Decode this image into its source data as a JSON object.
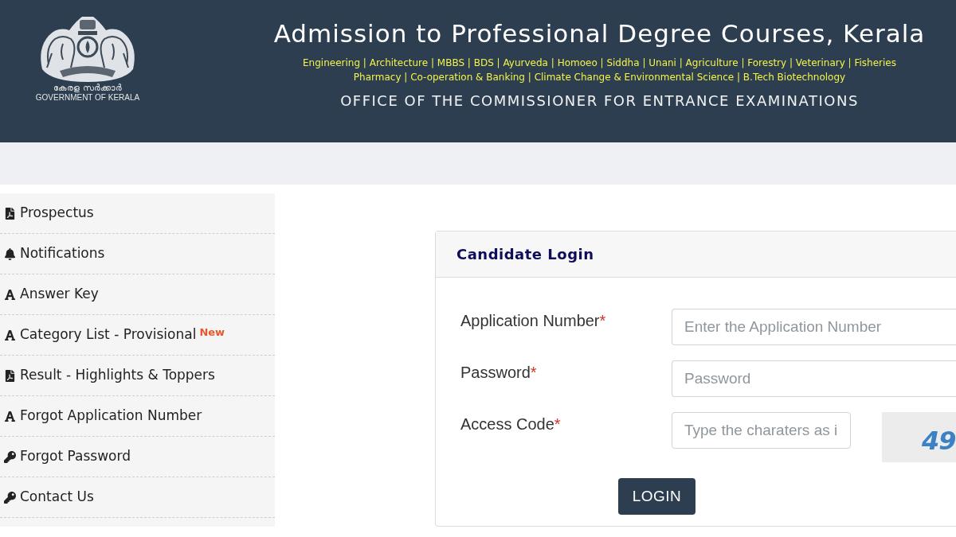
{
  "header": {
    "emblem_caption_native": "കേരള സർക്കാർ",
    "emblem_caption": "GOVERNMENT OF KERALA",
    "title": "Admission to Professional Degree Courses, Kerala",
    "course_lines": [
      "Engineering | Architecture | MBBS | BDS | Ayurveda | Homoeo | Siddha | Unani | Agriculture | Forestry | Veterinary | Fisheries",
      "Pharmacy | Co-operation & Banking | Climate Change & Environmental Science | B.Tech Biotechnology"
    ],
    "office": "OFFICE OF THE COMMISSIONER FOR ENTRANCE EXAMINATIONS"
  },
  "sidebar": {
    "items": [
      {
        "label": "Prospectus"
      },
      {
        "label": "Notifications"
      },
      {
        "label": "Answer Key"
      },
      {
        "label": "Category List - Provisional",
        "badge": "New"
      },
      {
        "label": "Result - Highlights & Toppers"
      },
      {
        "label": "Forgot Application Number"
      },
      {
        "label": "Forgot Password"
      },
      {
        "label": "Contact Us"
      }
    ]
  },
  "login_card": {
    "title": "Candidate Login",
    "fields": [
      {
        "kind": "text",
        "label": "Application Number",
        "required_mark": "*",
        "placeholder": "Enter the Application Number"
      },
      {
        "kind": "password",
        "label": "Password",
        "required_mark": "*",
        "placeholder": "Password"
      },
      {
        "kind": "captcha",
        "label": "Access Code",
        "required_mark": "*",
        "placeholder": "Type the charaters as i",
        "captcha_text": "49"
      }
    ],
    "button": "LOGIN"
  }
}
